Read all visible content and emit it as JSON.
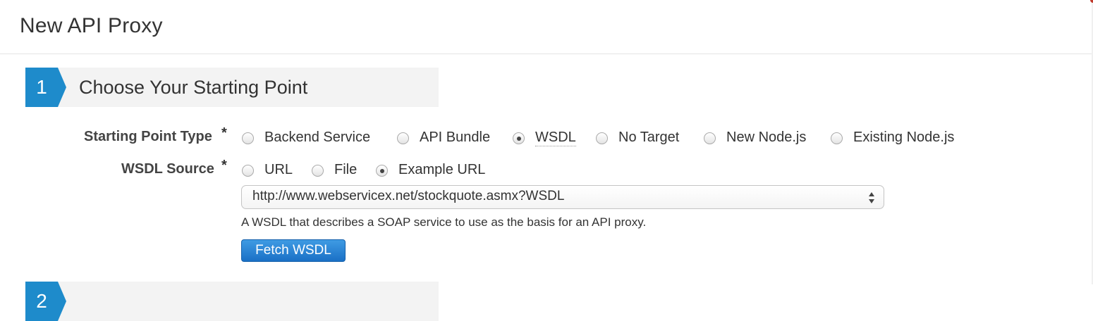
{
  "page": {
    "title": "New API Proxy"
  },
  "steps": [
    {
      "number": "1",
      "title": "Choose Your Starting Point"
    },
    {
      "number": "2",
      "title": ""
    }
  ],
  "starting_point_type": {
    "label": "Starting Point Type",
    "required_mark": "*",
    "options": [
      {
        "label": "Backend Service",
        "checked": false
      },
      {
        "label": "API Bundle",
        "checked": false
      },
      {
        "label": "WSDL",
        "checked": true
      },
      {
        "label": "No Target",
        "checked": false
      },
      {
        "label": "New Node.js",
        "checked": false
      },
      {
        "label": "Existing Node.js",
        "checked": false
      }
    ]
  },
  "wsdl_source": {
    "label": "WSDL Source",
    "required_mark": "*",
    "options": [
      {
        "label": "URL",
        "checked": false
      },
      {
        "label": "File",
        "checked": false
      },
      {
        "label": "Example URL",
        "checked": true
      }
    ],
    "select_value": "http://www.webservicex.net/stockquote.asmx?WSDL",
    "help_text": "A WSDL that describes a SOAP service to use as the basis for an API proxy.",
    "fetch_button": "Fetch WSDL"
  },
  "colors": {
    "accent": "#1e8bcb",
    "button": "#1a70c6"
  }
}
